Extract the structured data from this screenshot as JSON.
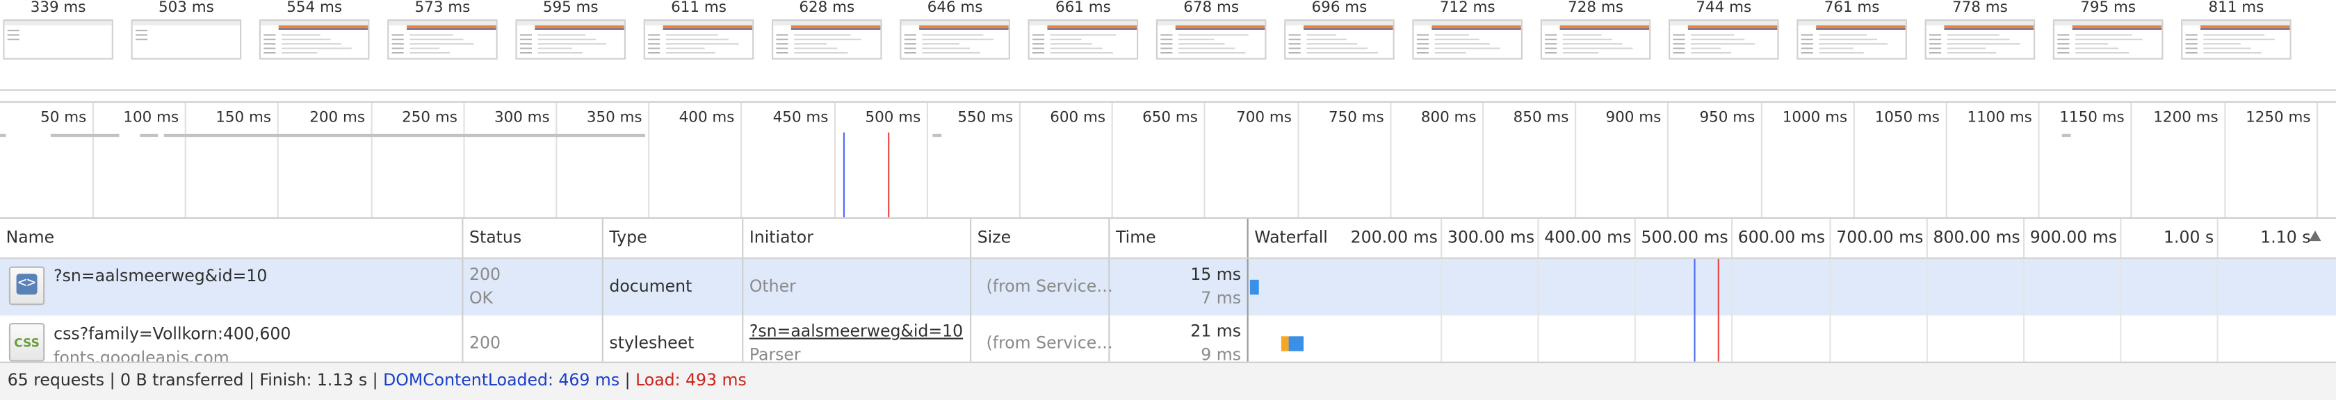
{
  "filmstrip": {
    "frames": [
      "339 ms",
      "503 ms",
      "554 ms",
      "573 ms",
      "595 ms",
      "611 ms",
      "628 ms",
      "646 ms",
      "661 ms",
      "678 ms",
      "696 ms",
      "712 ms",
      "728 ms",
      "744 ms",
      "761 ms",
      "778 ms",
      "795 ms",
      "811 ms"
    ]
  },
  "overview": {
    "ticks": [
      "50 ms",
      "100 ms",
      "150 ms",
      "200 ms",
      "250 ms",
      "300 ms",
      "350 ms",
      "400 ms",
      "450 ms",
      "500 ms",
      "550 ms",
      "600 ms",
      "650 ms",
      "700 ms",
      "750 ms",
      "800 ms",
      "850 ms",
      "900 ms",
      "950 ms",
      "1000 ms",
      "1050 ms",
      "1100 ms",
      "1150 ms",
      "1200 ms",
      "1250 ms"
    ]
  },
  "table": {
    "columns": {
      "name": "Name",
      "status": "Status",
      "type": "Type",
      "initiator": "Initiator",
      "size": "Size",
      "time": "Time",
      "waterfall": "Waterfall"
    },
    "waterfall_ticks": [
      "200.00 ms",
      "300.00 ms",
      "400.00 ms",
      "500.00 ms",
      "600.00 ms",
      "700.00 ms",
      "800.00 ms",
      "900.00 ms",
      "1.00 s",
      "1.10 s"
    ],
    "rows": [
      {
        "icon": "document-icon",
        "name": "?sn=aalsmeerweg&id=10",
        "domain": "",
        "status": "200",
        "status_text": "OK",
        "type": "document",
        "initiator": "Other",
        "initiator_detail": "",
        "size": "(from Service…",
        "time": "15 ms",
        "latency": "7 ms"
      },
      {
        "icon": "stylesheet-icon",
        "name": "css?family=Vollkorn:400,600",
        "domain": "fonts.googleapis.com",
        "status": "200",
        "status_text": "",
        "type": "stylesheet",
        "initiator": "?sn=aalsmeerweg&id=10",
        "initiator_detail": "Parser",
        "size": "(from Service…",
        "time": "21 ms",
        "latency": "9 ms"
      }
    ]
  },
  "icons": {
    "document_glyph": "<>",
    "stylesheet_glyph": "CSS"
  },
  "statusbar": {
    "summary": "65 requests | 0 B transferred | Finish: 1.13 s | ",
    "dcl": "DOMContentLoaded: 469 ms",
    "separator": " | ",
    "load": "Load: 493 ms"
  },
  "colors": {
    "dcl_line": "#4e6bf0",
    "load_line": "#e8473f",
    "selected_row": "#dfe9fa",
    "bar_waiting": "#f6a623",
    "bar_download": "#3a8fe6"
  }
}
